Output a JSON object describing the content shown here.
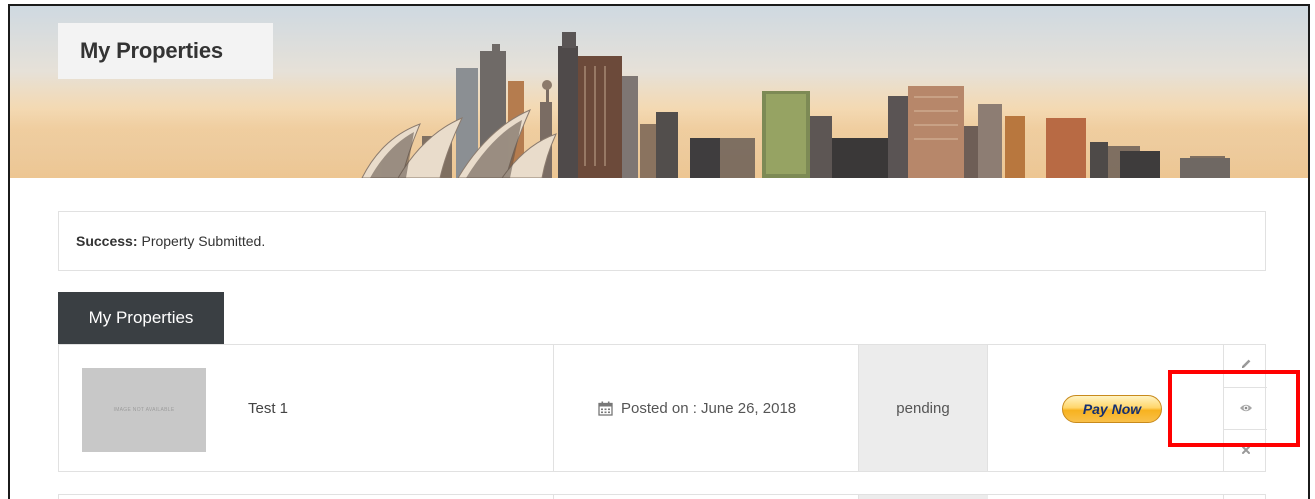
{
  "banner": {
    "title": "My Properties"
  },
  "alert": {
    "label": "Success:",
    "message": "Property Submitted."
  },
  "tab": {
    "label": "My Properties"
  },
  "properties": [
    {
      "thumbnail_text": "IMAGE NOT AVAILABLE",
      "name": "Test 1",
      "posted_label": "Posted on : June 26, 2018",
      "status": "pending",
      "pay_label": "Pay Now"
    }
  ],
  "icons": {
    "calendar": "calendar-icon",
    "edit": "pencil-icon",
    "view": "eye-icon",
    "delete": "close-icon"
  },
  "colors": {
    "tab_bg": "#3a3f43",
    "status_bg": "#ececec",
    "pay_button": "#f7b21f",
    "pay_text": "#153071",
    "highlight": "#ff0000"
  }
}
